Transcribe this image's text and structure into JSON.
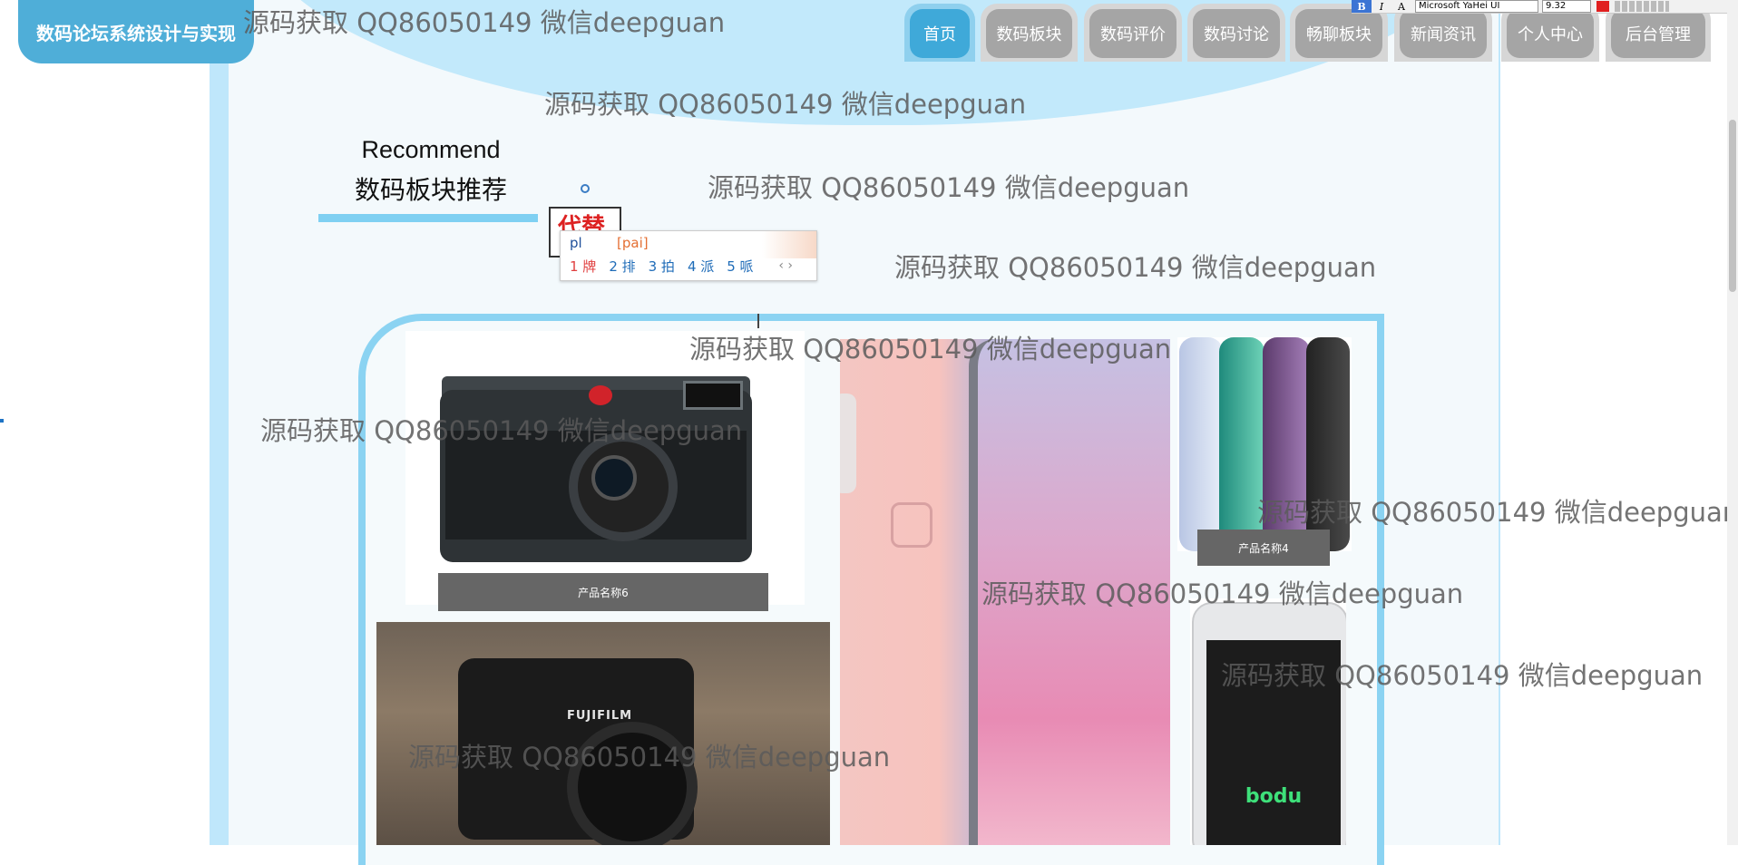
{
  "brand": {
    "title": "数码论坛系统设计与实现"
  },
  "nav": {
    "items": [
      {
        "label": "首页"
      },
      {
        "label": "数码板块"
      },
      {
        "label": "数码评价"
      },
      {
        "label": "数码讨论"
      },
      {
        "label": "畅聊板块"
      },
      {
        "label": "新闻资讯"
      },
      {
        "label": "个人中心"
      },
      {
        "label": "后台管理"
      }
    ]
  },
  "toolbar": {
    "bold": "B",
    "italic": "I",
    "font_size_icon": "A",
    "font_name": "Microsoft YaHei UI",
    "font_size": "9.32"
  },
  "section": {
    "title_en": "Recommend",
    "title_zh": "数码板块推荐"
  },
  "ime": {
    "composition": "代替",
    "input": "pl",
    "pinyin": "[pai]",
    "candidates": [
      "1 牌",
      "2 排",
      "3 拍",
      "4 派",
      "5 哌"
    ],
    "nav": "‹  ›"
  },
  "products": [
    {
      "caption": "产品名称6"
    },
    {
      "caption": "产品名称4"
    }
  ],
  "product_labels": {
    "fuji_brand": "FUJIFILM",
    "bodu_logo": "bodu"
  },
  "watermark": "源码获取 QQ86050149 微信deepguan",
  "colors": {
    "accent": "#3fa9d9",
    "nav_inactive": "#a5a5a5",
    "frame": "#bfe7fb",
    "caption_bg": "#666666"
  }
}
